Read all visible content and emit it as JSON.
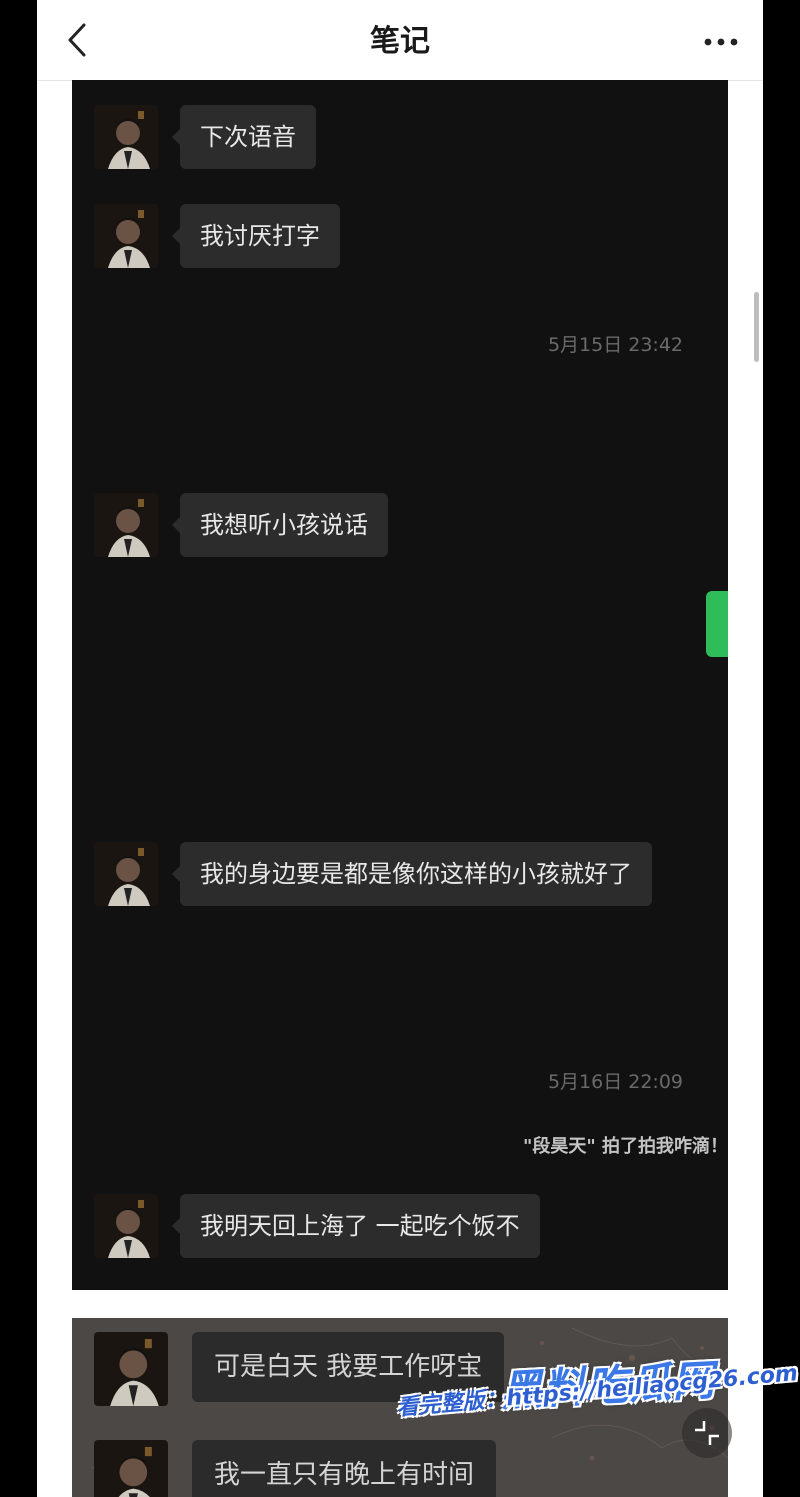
{
  "navbar": {
    "title": "笔记",
    "back_icon": "chevron-left-icon",
    "more_icon": "more-dots-icon"
  },
  "chat": {
    "messages": [
      {
        "text": "下次语音"
      },
      {
        "text": "我讨厌打字"
      },
      {
        "text": "我想听小孩说话"
      },
      {
        "text": "我的身边要是都是像你这样的小孩就好了"
      },
      {
        "text": "我明天回上海了 一起吃个饭不"
      }
    ],
    "timestamps": [
      "5月15日 23:42",
      "5月16日 22:09"
    ],
    "system_note": "\"段昊天\" 拍了拍我咋滴！"
  },
  "chat2": {
    "messages": [
      {
        "text": "可是白天 我要工作呀宝"
      },
      {
        "text": "我一直只有晚上有时间"
      }
    ]
  },
  "watermark": {
    "brand": "黑料吃瓜网",
    "url_text": "看完整版：https://heiliaocg26.com"
  },
  "colors": {
    "accent_green": "#2fbd5a",
    "bubble": "#2c2c2c",
    "chat_background": "#111112",
    "watermark_blue": "#3b78e7"
  }
}
